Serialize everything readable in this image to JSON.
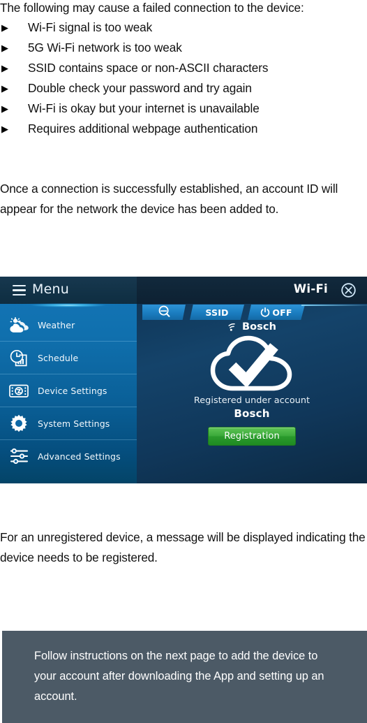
{
  "intro": {
    "heading": "The following may cause a failed connection to the device:"
  },
  "causes": {
    "marker": "▶",
    "items": [
      "Wi-Fi signal is too weak",
      "5G Wi-Fi network is too weak",
      "SSID contains space or non-ASCII characters",
      "Double check your password and try again",
      "Wi-Fi is okay but your internet is unavailable",
      "Requires additional webpage authentication"
    ]
  },
  "paragraphs": {
    "connection_success": "Once a connection is successfully established, an account ID will appear for the network the device has been added to.",
    "unregistered": "For an unregistered device, a message will be displayed indicating the device needs to be registered."
  },
  "device_screen": {
    "sidebar": {
      "menu_label": "Menu",
      "hamburger_icon": "hamburger-menu-icon",
      "items": [
        {
          "label": "Weather",
          "icon": "weather-cloud-sun-icon"
        },
        {
          "label": "Schedule",
          "icon": "schedule-clock-chart-icon"
        },
        {
          "label": "Device Settings",
          "icon": "device-settings-icon"
        },
        {
          "label": "System Settings",
          "icon": "gear-icon"
        },
        {
          "label": "Advanced Settings",
          "icon": "sliders-icon"
        }
      ]
    },
    "panel": {
      "title": "Wi-Fi",
      "close_icon": "close-circle-x-icon",
      "tabs": [
        {
          "label": "",
          "icon": "search-magnifier-icon",
          "name": "tab-search"
        },
        {
          "label": "SSID",
          "icon": "",
          "name": "tab-ssid"
        },
        {
          "label": "OFF",
          "icon": "power-icon",
          "name": "tab-power-off"
        }
      ],
      "ssid_icon": "wifi-signal-icon",
      "ssid_name": "Bosch",
      "status_icon": "cloud-check-icon",
      "registered_caption": "Registered under account",
      "registered_account": "Bosch",
      "registration_button": "Registration"
    },
    "colors": {
      "sidebar_blue": "#1476b8",
      "panel_blue": "#14436a",
      "header_dark": "#12293d",
      "tab_blue": "#1b7dc0",
      "button_green": "#2a9a2c",
      "glow_cyan": "#a5e7ff"
    }
  },
  "note": {
    "text": "Follow instructions on the next page to add the device to your account after downloading the App and setting up an account.",
    "background": "#4c5a66"
  }
}
